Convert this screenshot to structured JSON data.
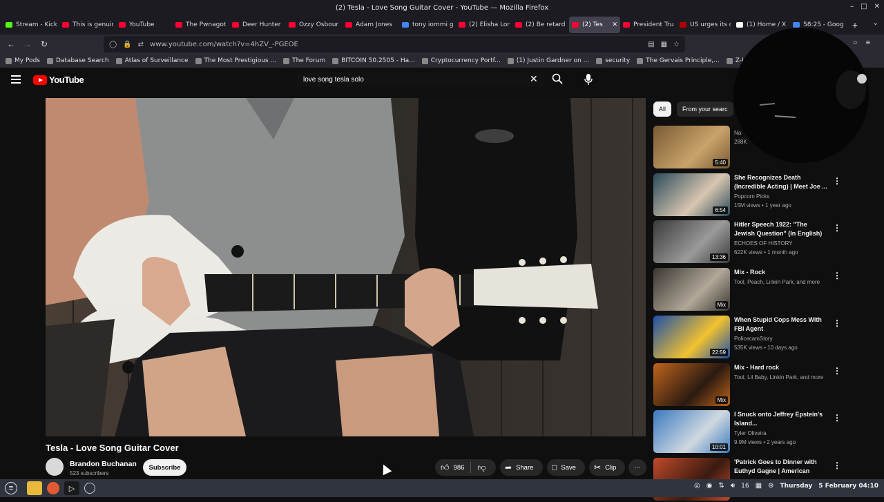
{
  "window": {
    "title": "(2) Tesla - Love Song Guitar Cover - YouTube — Mozilla Firefox",
    "min_icon": "minimize-icon",
    "max_icon": "maximize-icon",
    "close_icon": "close-icon"
  },
  "tabs": [
    {
      "label": "Stream - Kick",
      "favicon_color": "#53fc18"
    },
    {
      "label": "This is genuin",
      "favicon_color": "#ff0033"
    },
    {
      "label": "YouTube",
      "favicon_color": "#ff0033"
    },
    {
      "label": "The Pwnagot",
      "favicon_color": "#ff0033"
    },
    {
      "label": "Deer Hunter",
      "favicon_color": "#ff0033"
    },
    {
      "label": "Ozzy Osbour",
      "favicon_color": "#ff0033"
    },
    {
      "label": "Adam Jones",
      "favicon_color": "#ff0033"
    },
    {
      "label": "tony iommi g",
      "favicon_color": "#4285f4"
    },
    {
      "label": "(2) Elisha Lor",
      "favicon_color": "#ff0033"
    },
    {
      "label": "(2) Be retard",
      "favicon_color": "#ff0033"
    },
    {
      "label": "(2) Tes",
      "favicon_color": "#ff0033",
      "active": true
    },
    {
      "label": "President Tru",
      "favicon_color": "#ff0033"
    },
    {
      "label": "US urges its c",
      "favicon_color": "#b50000"
    },
    {
      "label": "(1) Home / X",
      "favicon_color": "#ffffff"
    },
    {
      "label": "58:25 - Goog",
      "favicon_color": "#4285f4"
    }
  ],
  "navbar": {
    "url": "www.youtube.com/watch?v=4hZV_-PGEOE"
  },
  "bookmarks": [
    "My Pods",
    "Database Search",
    "Atlas of Surveillance",
    "The Most Prestigious ...",
    "The Forum",
    "BITCOIN 50.2505 - Ha...",
    "Cryptocurrency Portf...",
    "(1) Justin Gardner on ...",
    "security",
    "The Gervais Principle,...",
    "Z-Library – the world'"
  ],
  "youtube": {
    "logo_text": "YouTube",
    "search_value": "love song tesla solo",
    "video_title": "Tesla - Love Song Guitar Cover",
    "channel": "Brandon Buchanan",
    "subscribers": "523 subscribers",
    "subscribe_label": "Subscribe",
    "likes": "986",
    "share_label": "Share",
    "save_label": "Save",
    "clip_label": "Clip"
  },
  "chips": [
    "All",
    "From your searc"
  ],
  "recommendations": [
    {
      "title": "",
      "channel": "Na",
      "meta": "288K",
      "duration": "5:40",
      "thumb_colors": [
        "#7a5a34",
        "#c9a36a"
      ]
    },
    {
      "title": "She Recognizes Death\n(Incredible Acting) | Meet Joe ...",
      "channel": "Popcorn Picks",
      "meta": "15M views • 1 year ago",
      "duration": "6:54",
      "thumb_colors": [
        "#2a4a5a",
        "#d8c6b0"
      ]
    },
    {
      "title": "Hitler Speech 1922: \"The\nJewish Question\" (In English)",
      "channel": "ECHOES OF HISTORY",
      "meta": "622K views • 1 month ago",
      "duration": "13:36",
      "thumb_colors": [
        "#3a3a3a",
        "#9a9a9a"
      ]
    },
    {
      "title": "Mix - Rock",
      "channel": "Tool, Peach, Linkin Park, and more",
      "meta": "",
      "duration": "Mix",
      "thumb_colors": [
        "#3a3530",
        "#b0a898"
      ]
    },
    {
      "title": "When Stupid Cops Mess With\nFBI Agent",
      "channel": "PolicecamStory",
      "meta": "535K views • 10 days ago",
      "duration": "22:59",
      "thumb_colors": [
        "#1d4fa8",
        "#f2c230"
      ]
    },
    {
      "title": "Mix - Hard rock",
      "channel": "Tool, Lil Baby, Linkin Park, and more",
      "meta": "",
      "duration": "Mix",
      "thumb_colors": [
        "#c0641c",
        "#2a1a10"
      ]
    },
    {
      "title": "I Snuck onto Jeffrey Epstein's\nIsland...",
      "channel": "Tyler Oliveira",
      "meta": "9.9M views • 2 years ago",
      "duration": "10:01",
      "thumb_colors": [
        "#3a7ac0",
        "#d0d8e0"
      ]
    },
    {
      "title": "'Patrick Goes to Dinner with\nEuthyd Gagne | American",
      "channel": "",
      "meta": "",
      "duration": "",
      "thumb_colors": [
        "#c04a2a",
        "#3a1a10"
      ]
    }
  ],
  "taskbar": {
    "tray_number": "16",
    "day": "Thursday",
    "date_time": "5 February 04:10"
  },
  "colors": {
    "accent": "#ff0000",
    "background": "#0f0f0f",
    "pill": "#272727"
  }
}
